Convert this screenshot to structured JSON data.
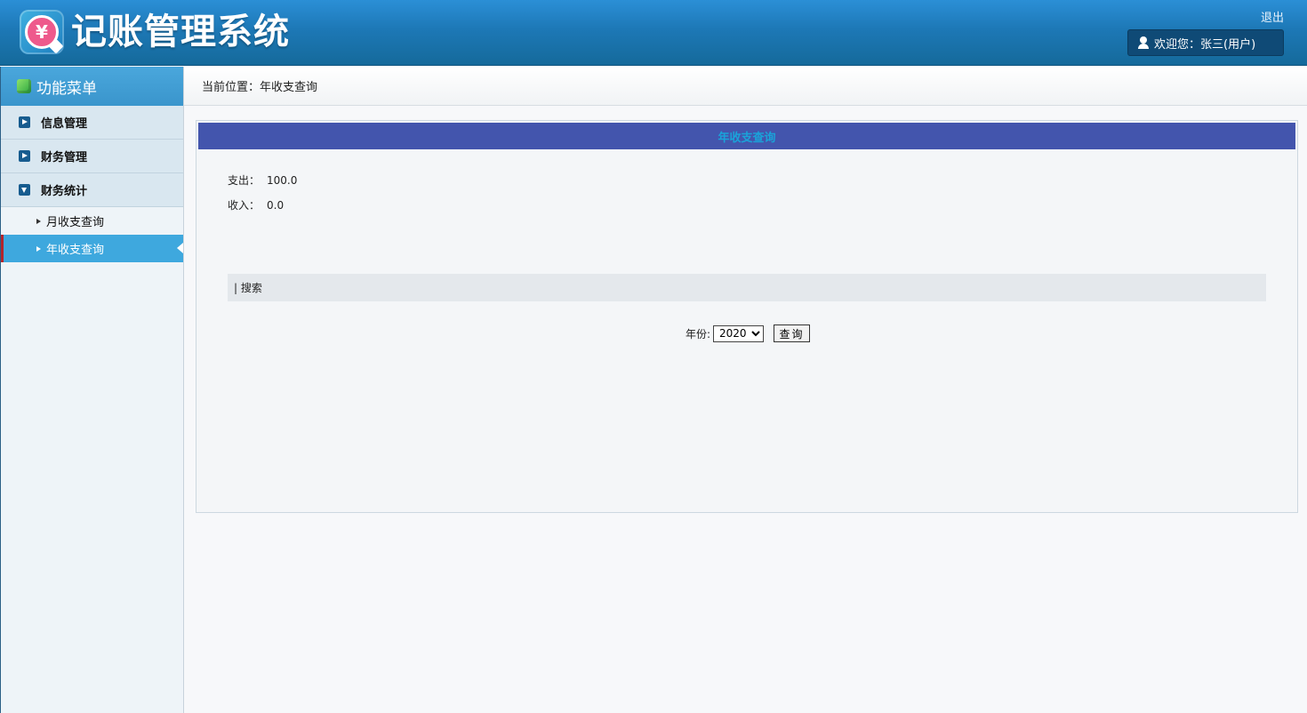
{
  "header": {
    "logo_symbol": "¥",
    "title": "记账管理系统",
    "logout_label": "退出",
    "welcome_text": "欢迎您：张三(用户)"
  },
  "sidebar": {
    "title": "功能菜单",
    "groups": [
      {
        "label": "信息管理",
        "expanded": false
      },
      {
        "label": "财务管理",
        "expanded": false
      },
      {
        "label": "财务统计",
        "expanded": true
      }
    ],
    "sub_items": [
      {
        "label": "月收支查询",
        "active": false
      },
      {
        "label": "年收支查询",
        "active": true
      }
    ]
  },
  "breadcrumb": {
    "text": "当前位置：年收支查询"
  },
  "panel": {
    "title": "年收支查询",
    "expense_label": "支出：",
    "expense_value": "100.0",
    "income_label": "收入：",
    "income_value": "0.0",
    "search_header": "| 搜索",
    "year_label": "年份:",
    "year_selected": "2020",
    "query_label": "查询"
  },
  "colors": {
    "header_blue": "#1d78b6",
    "panel_title_bg": "#4355ad",
    "panel_title_text": "#1aa3d9",
    "active_item": "#3ea8de",
    "active_marker": "#b3252c"
  }
}
